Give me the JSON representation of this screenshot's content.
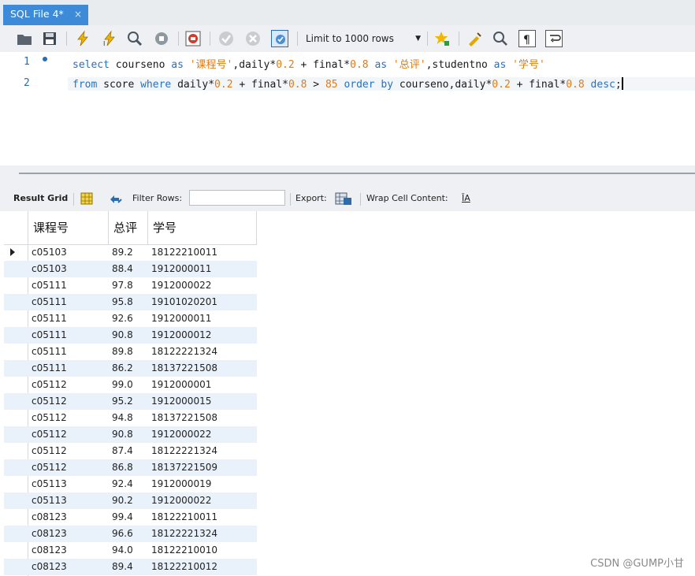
{
  "tab": {
    "title": "SQL File 4*",
    "close": "×"
  },
  "toolbar": {
    "limit_label": "Limit to 1000 rows",
    "icons": [
      "folder-open-icon",
      "save-icon",
      "execute-icon",
      "execute-current-icon",
      "explain-icon",
      "stop-icon",
      "stop-on-error-icon",
      "commit-icon",
      "rollback-icon",
      "autocommit-icon",
      "limit-dropdown",
      "beautify-icon",
      "find-icon",
      "invisible-chars-icon",
      "wrap-icon"
    ]
  },
  "editor": {
    "lines": [
      {
        "num": "1",
        "has_marker": true
      },
      {
        "num": "2",
        "has_marker": false
      }
    ],
    "line1": {
      "t1": "select",
      "t2": " courseno ",
      "t3": "as",
      "t4": " ",
      "t5": "'课程号'",
      "t6": ",daily*",
      "t7": "0.2",
      "t8": " + final*",
      "t9": "0.8",
      "t10": " ",
      "t11": "as",
      "t12": " ",
      "t13": "'总评'",
      "t14": ",studentno ",
      "t15": "as",
      "t16": " ",
      "t17": "'学号'"
    },
    "line2": {
      "t1": "from",
      "t2": " score ",
      "t3": "where",
      "t4": " daily*",
      "t5": "0.2",
      "t6": " + final*",
      "t7": "0.8",
      "t8": " > ",
      "t9": "85",
      "t10": " ",
      "t11": "order",
      "t12": " ",
      "t13": "by",
      "t14": " courseno,daily*",
      "t15": "0.2",
      "t16": " + final*",
      "t17": "0.8",
      "t18": " ",
      "t19": "desc",
      "t20": ";"
    }
  },
  "result_toolbar": {
    "result_grid": "Result Grid",
    "filter_rows": "Filter Rows:",
    "export": "Export:",
    "wrap": "Wrap Cell Content:",
    "wrap_icon": "ĪA"
  },
  "grid": {
    "columns": [
      "课程号",
      "总评",
      "学号"
    ],
    "rows": [
      [
        "c05103",
        "89.2",
        "18122210011"
      ],
      [
        "c05103",
        "88.4",
        "1912000011"
      ],
      [
        "c05111",
        "97.8",
        "1912000022"
      ],
      [
        "c05111",
        "95.8",
        "19101020201"
      ],
      [
        "c05111",
        "92.6",
        "1912000011"
      ],
      [
        "c05111",
        "90.8",
        "1912000012"
      ],
      [
        "c05111",
        "89.8",
        "18122221324"
      ],
      [
        "c05111",
        "86.2",
        "18137221508"
      ],
      [
        "c05112",
        "99.0",
        "1912000001"
      ],
      [
        "c05112",
        "95.2",
        "1912000015"
      ],
      [
        "c05112",
        "94.8",
        "18137221508"
      ],
      [
        "c05112",
        "90.8",
        "1912000022"
      ],
      [
        "c05112",
        "87.4",
        "18122221324"
      ],
      [
        "c05112",
        "86.8",
        "18137221509"
      ],
      [
        "c05113",
        "92.4",
        "1912000019"
      ],
      [
        "c05113",
        "90.2",
        "1912000022"
      ],
      [
        "c08123",
        "99.4",
        "18122210011"
      ],
      [
        "c08123",
        "96.6",
        "18122221324"
      ],
      [
        "c08123",
        "94.0",
        "18122210010"
      ],
      [
        "c08123",
        "89.4",
        "18122210012"
      ]
    ]
  },
  "watermark": "CSDN @GUMP小甘",
  "colors": {
    "tab": "#3d8bd8",
    "keyword": "#2470c7",
    "string": "#e07b14",
    "row_alt": "#e9f1fb"
  }
}
